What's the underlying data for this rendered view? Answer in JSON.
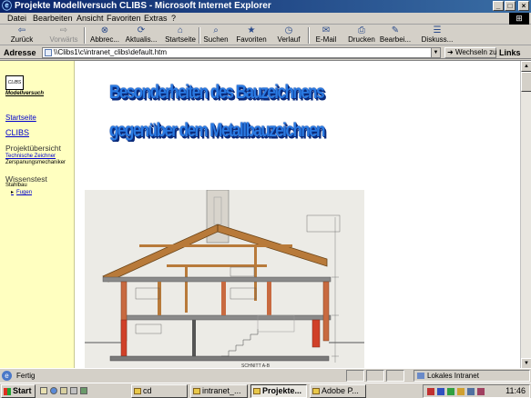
{
  "window": {
    "title": "Projekte Modellversuch CLIBS - Microsoft Internet Explorer",
    "controls": [
      "_",
      "□",
      "×"
    ]
  },
  "menu": {
    "items": [
      "Datei",
      "Bearbeiten",
      "Ansicht",
      "Favoriten",
      "Extras",
      "?"
    ]
  },
  "toolbar": {
    "buttons": [
      {
        "label": "Zurück",
        "icon": "back-arrow-icon",
        "glyph": "⇦",
        "enabled": true
      },
      {
        "label": "Vorwärts",
        "icon": "forward-arrow-icon",
        "glyph": "⇨",
        "enabled": false
      },
      {
        "label": "Abbrec...",
        "icon": "stop-icon",
        "glyph": "⊗",
        "enabled": true
      },
      {
        "label": "Aktualis...",
        "icon": "refresh-icon",
        "glyph": "⟳",
        "enabled": true
      },
      {
        "label": "Startseite",
        "icon": "home-icon",
        "glyph": "⌂",
        "enabled": true
      },
      {
        "label": "Suchen",
        "icon": "search-icon",
        "glyph": "⌕",
        "enabled": true
      },
      {
        "label": "Favoriten",
        "icon": "favorites-icon",
        "glyph": "★",
        "enabled": true
      },
      {
        "label": "Verlauf",
        "icon": "history-icon",
        "glyph": "◷",
        "enabled": true
      },
      {
        "label": "E-Mail",
        "icon": "mail-icon",
        "glyph": "✉",
        "enabled": true
      },
      {
        "label": "Drucken",
        "icon": "print-icon",
        "glyph": "⎙",
        "enabled": true
      },
      {
        "label": "Bearbei...",
        "icon": "edit-icon",
        "glyph": "✎",
        "enabled": true
      },
      {
        "label": "Diskuss...",
        "icon": "discuss-icon",
        "glyph": "☰",
        "enabled": true
      }
    ]
  },
  "address": {
    "label": "Adresse",
    "value": "\\\\Clibs1\\c\\intranet_clibs\\default.htm",
    "go_label": "Wechseln zu",
    "links_label": "Links"
  },
  "sidebar": {
    "logo_mark": "CLIBS",
    "logo_text": "Modellversuch",
    "startseite": "Startseite",
    "clibs": "CLIBS",
    "projekt_heading": "Projektübersicht",
    "projekt_sub1": "Technische Zeichner",
    "projekt_sub2": "Zerspanungsmechaniker",
    "wissenstest_heading": "Wissenstest",
    "wissenstest_sub": "Stahlbau",
    "fugen": "Fugen"
  },
  "main": {
    "heading_line1": "Besonderheiten des Bauzeichnens",
    "heading_line2": "gegenüber dem Metallbauzeichnen",
    "drawing_caption": "SCHNITT A-B"
  },
  "status": {
    "text": "Fertig",
    "zone": "Lokales Intranet"
  },
  "taskbar": {
    "start": "Start",
    "tasks": [
      {
        "label": "cd",
        "active": false
      },
      {
        "label": "intranet_...",
        "active": false
      },
      {
        "label": "Projekte...",
        "active": true
      },
      {
        "label": "Adobe P...",
        "active": false
      }
    ],
    "clock": "11:46"
  }
}
